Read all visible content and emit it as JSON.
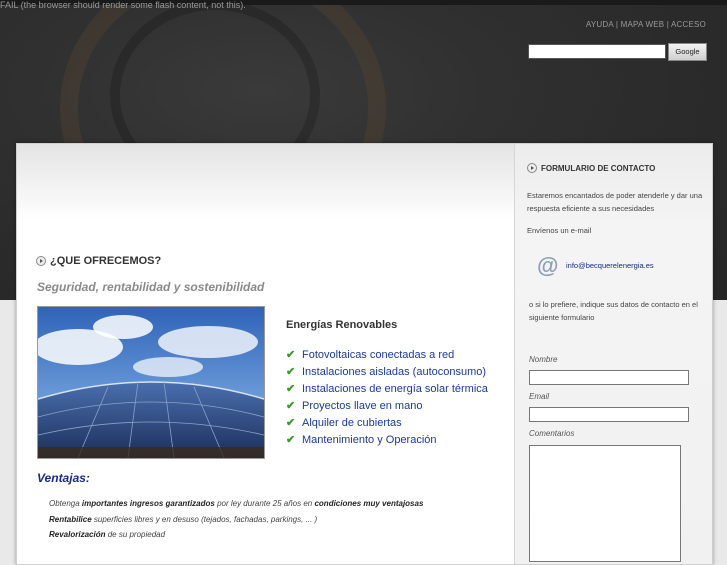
{
  "flash_fallback": "FAIL (the browser should render some flash content, not this).",
  "top_nav": {
    "ayuda": "AYUDA",
    "sep": "|",
    "mapa": "MAPA WEB",
    "acceso": "ACCESO"
  },
  "search": {
    "value": "",
    "button": "Google"
  },
  "main": {
    "section_title": "¿QUE OFRECEMOS?",
    "subtitle": "Seguridad, rentabilidad y sostenibilidad",
    "renewables_title": "Energías Renovables",
    "services": [
      "Fotovoltaicas conectadas a red",
      "Instalaciones aisladas (autoconsumo)",
      "Instalaciones de energía solar térmica",
      "Proyectos llave en mano",
      "Alquiler de cubiertas",
      "Mantenimiento y Operación"
    ],
    "ventajas_title": "Ventajas:",
    "ventajas": [
      {
        "pre": "Obtenga ",
        "bold": "importantes ingresos garantizados",
        "mid": " por ley durante 25 años en ",
        "bold2": "condiciones muy ventajosas",
        "post": ""
      },
      {
        "pre": "",
        "bold": "Rentabilice",
        "mid": " superficies libres y en desuso (tejados, fachadas, parkings, ... )",
        "bold2": "",
        "post": ""
      },
      {
        "pre": "",
        "bold": "Revalorización",
        "mid": " de su propiedad",
        "bold2": "",
        "post": ""
      }
    ]
  },
  "contact": {
    "title": "FORMULARIO DE CONTACTO",
    "intro": "Estaremos encantados de poder atenderle y dar una respuesta eficiente a sus necesidades",
    "send_email": "Envíenos un e-mail",
    "email": "info@becquerelenergia.es",
    "alt_text": "o si lo prefiere, indique sus datos de contacto en el siguiente formulario",
    "labels": {
      "name": "Nombre",
      "email": "Email",
      "comments": "Comentarios"
    },
    "values": {
      "name": "",
      "email": "",
      "comments": ""
    }
  }
}
